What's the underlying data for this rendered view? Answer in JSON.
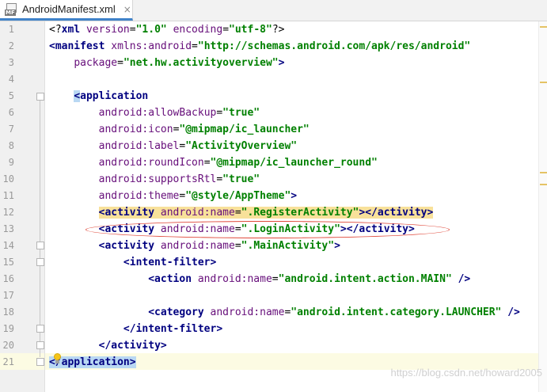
{
  "tab": {
    "icon": "android-manifest-file-icon",
    "badge": "MF",
    "title": "AndroidManifest.xml",
    "close": "×"
  },
  "lines": [
    {
      "n": "1",
      "segs": [
        [
          "p",
          "<?"
        ],
        [
          "t",
          "xml "
        ],
        [
          "a",
          "version"
        ],
        [
          "p",
          "="
        ],
        [
          "v",
          "\"1.0\""
        ],
        [
          "p",
          " "
        ],
        [
          "a",
          "encoding"
        ],
        [
          "p",
          "="
        ],
        [
          "v",
          "\"utf-8\""
        ],
        [
          "p",
          "?>"
        ]
      ]
    },
    {
      "n": "2",
      "segs": [
        [
          "t",
          "<manifest "
        ],
        [
          "ns",
          "xmlns:"
        ],
        [
          "a",
          "android"
        ],
        [
          "p",
          "="
        ],
        [
          "v",
          "\"http://schemas.android.com/apk/res/android\""
        ]
      ]
    },
    {
      "n": "3",
      "segs": [
        [
          "p",
          "    "
        ],
        [
          "a",
          "package"
        ],
        [
          "p",
          "="
        ],
        [
          "v",
          "\"net.hw.activityoverview\""
        ],
        [
          "t",
          ">"
        ]
      ]
    },
    {
      "n": "4",
      "segs": []
    },
    {
      "n": "5",
      "segs": [
        [
          "p",
          "    "
        ],
        [
          "bb",
          "<"
        ],
        [
          "t",
          "application"
        ]
      ]
    },
    {
      "n": "6",
      "segs": [
        [
          "p",
          "        "
        ],
        [
          "ns",
          "android:"
        ],
        [
          "a",
          "allowBackup"
        ],
        [
          "p",
          "="
        ],
        [
          "v",
          "\"true\""
        ]
      ]
    },
    {
      "n": "7",
      "segs": [
        [
          "p",
          "        "
        ],
        [
          "ns",
          "android:"
        ],
        [
          "a",
          "icon"
        ],
        [
          "p",
          "="
        ],
        [
          "v",
          "\"@mipmap/ic_launcher\""
        ]
      ]
    },
    {
      "n": "8",
      "segs": [
        [
          "p",
          "        "
        ],
        [
          "ns",
          "android:"
        ],
        [
          "a",
          "label"
        ],
        [
          "p",
          "="
        ],
        [
          "v",
          "\"ActivityOverview\""
        ]
      ]
    },
    {
      "n": "9",
      "segs": [
        [
          "p",
          "        "
        ],
        [
          "ns",
          "android:"
        ],
        [
          "a",
          "roundIcon"
        ],
        [
          "p",
          "="
        ],
        [
          "v",
          "\"@mipmap/ic_launcher_round\""
        ]
      ]
    },
    {
      "n": "10",
      "segs": [
        [
          "p",
          "        "
        ],
        [
          "ns",
          "android:"
        ],
        [
          "a",
          "supportsRtl"
        ],
        [
          "p",
          "="
        ],
        [
          "v",
          "\"true\""
        ]
      ]
    },
    {
      "n": "11",
      "segs": [
        [
          "p",
          "        "
        ],
        [
          "ns",
          "android:"
        ],
        [
          "a",
          "theme"
        ],
        [
          "p",
          "="
        ],
        [
          "v",
          "\"@style/AppTheme\""
        ],
        [
          "t",
          ">"
        ]
      ]
    },
    {
      "n": "12",
      "segs": [
        [
          "p",
          "        "
        ],
        [
          "bt",
          "<activity "
        ],
        [
          "btns",
          "android:"
        ],
        [
          "bta",
          "name"
        ],
        [
          "btp",
          "="
        ],
        [
          "btv",
          "\".RegisterActivity\""
        ],
        [
          "bt",
          "></activity>"
        ]
      ]
    },
    {
      "n": "13",
      "segs": [
        [
          "p",
          "        "
        ],
        [
          "t",
          "<activity "
        ],
        [
          "ns",
          "android:"
        ],
        [
          "a",
          "name"
        ],
        [
          "p",
          "="
        ],
        [
          "v",
          "\".LoginActivity\""
        ],
        [
          "t",
          "></activity>"
        ]
      ]
    },
    {
      "n": "14",
      "segs": [
        [
          "p",
          "        "
        ],
        [
          "t",
          "<activity "
        ],
        [
          "ns",
          "android:"
        ],
        [
          "a",
          "name"
        ],
        [
          "p",
          "="
        ],
        [
          "v",
          "\".MainActivity\""
        ],
        [
          "t",
          ">"
        ]
      ]
    },
    {
      "n": "15",
      "segs": [
        [
          "p",
          "            "
        ],
        [
          "t",
          "<intent-filter>"
        ]
      ]
    },
    {
      "n": "16",
      "segs": [
        [
          "p",
          "                "
        ],
        [
          "t",
          "<action "
        ],
        [
          "ns",
          "android:"
        ],
        [
          "a",
          "name"
        ],
        [
          "p",
          "="
        ],
        [
          "v",
          "\"android.intent.action.MAIN\""
        ],
        [
          "t",
          " />"
        ]
      ]
    },
    {
      "n": "17",
      "segs": []
    },
    {
      "n": "18",
      "segs": [
        [
          "p",
          "                "
        ],
        [
          "t",
          "<category "
        ],
        [
          "ns",
          "android:"
        ],
        [
          "a",
          "name"
        ],
        [
          "p",
          "="
        ],
        [
          "v",
          "\"android.intent.category.LAUNCHER\""
        ],
        [
          "t",
          " />"
        ]
      ]
    },
    {
      "n": "19",
      "segs": [
        [
          "p",
          "            "
        ],
        [
          "t",
          "</intent-filter>"
        ]
      ]
    },
    {
      "n": "20",
      "segs": [
        [
          "p",
          "        "
        ],
        [
          "t",
          "</activity>"
        ]
      ]
    },
    {
      "n": "21",
      "segs": [
        [
          "bb",
          "</application>"
        ]
      ]
    }
  ],
  "watermark": "https://blog.csdn.net/howard2005",
  "colors": {
    "tag": "#000080",
    "attr": "#660e7a",
    "value": "#008000",
    "highlight": "#f8e19a",
    "brace-match": "#b9d8f3",
    "annotation": "#e0483a"
  }
}
